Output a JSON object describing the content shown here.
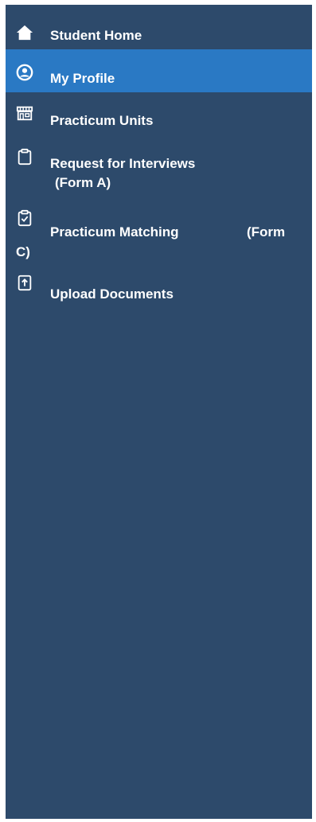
{
  "colors": {
    "sidebar_bg": "#2d4a6b",
    "active_bg": "#2a79c4",
    "text": "#ffffff"
  },
  "nav": {
    "items": [
      {
        "label": "Student Home",
        "icon": "home-icon"
      },
      {
        "label": "My Profile",
        "icon": "user-circle-icon",
        "active": true
      },
      {
        "label": "Practicum Units",
        "icon": "storefront-icon"
      },
      {
        "label_line1": "Request for Interviews",
        "label_line2": "(Form A)",
        "icon": "clipboard-icon"
      },
      {
        "label_line1": "Practicum Matching",
        "label_line1b": "(Form",
        "label_line2": "C)",
        "icon": "clipboard-check-icon"
      },
      {
        "label": "Upload Documents",
        "icon": "upload-file-icon"
      }
    ]
  }
}
